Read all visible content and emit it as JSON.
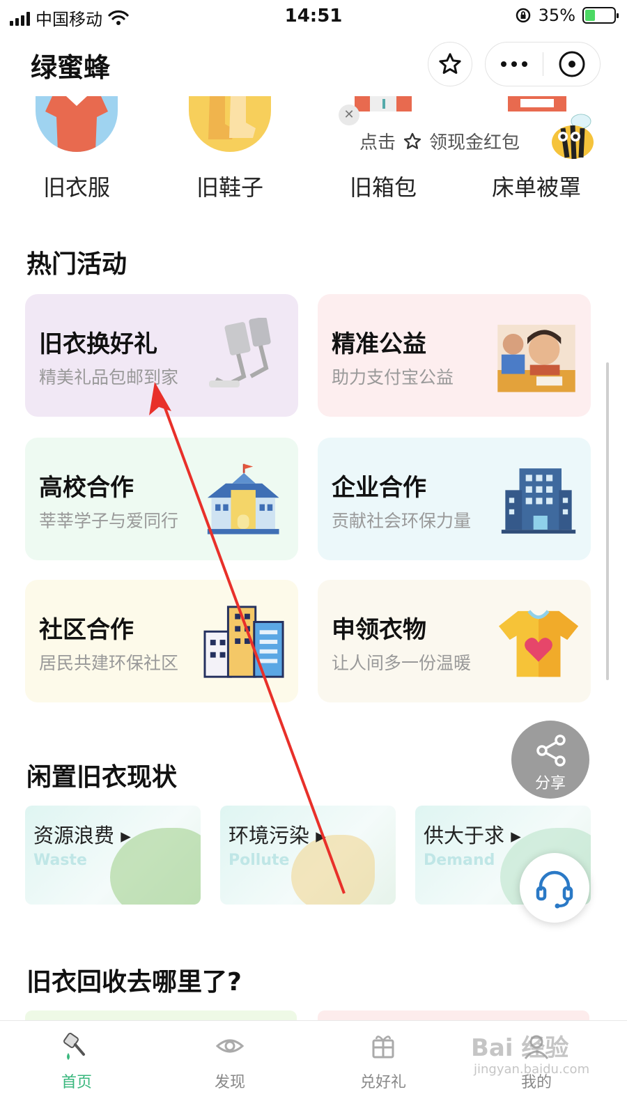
{
  "status_bar": {
    "carrier": "中国移动",
    "time": "14:51",
    "battery_text": "35%",
    "battery_level": 0.35
  },
  "header": {
    "title": "绿蜜蜂"
  },
  "categories": [
    {
      "label": "旧衣服",
      "icon": "shirt-icon"
    },
    {
      "label": "旧鞋子",
      "icon": "boots-icon"
    },
    {
      "label": "旧箱包",
      "icon": "suitcase-icon"
    },
    {
      "label": "床单被罩",
      "icon": "bedding-icon"
    }
  ],
  "red_packet": {
    "prefix": "点击",
    "text": "领现金红包"
  },
  "hot_activities": {
    "title": "热门活动",
    "cards": [
      {
        "title": "旧衣换好礼",
        "subtitle": "精美礼品包邮到家",
        "bg": "#f1e8f5",
        "icon": "phone-stand-icon"
      },
      {
        "title": "精准公益",
        "subtitle": "助力支付宝公益",
        "bg": "#fdeeef",
        "icon": "children-photo"
      },
      {
        "title": "高校合作",
        "subtitle": "莘莘学子与爱同行",
        "bg": "#eefaf2",
        "icon": "school-icon"
      },
      {
        "title": "企业合作",
        "subtitle": "贡献社会环保力量",
        "bg": "#ecf8fa",
        "icon": "office-building-icon"
      },
      {
        "title": "社区合作",
        "subtitle": "居民共建环保社区",
        "bg": "#fdfaea",
        "icon": "community-buildings-icon"
      },
      {
        "title": "申领衣物",
        "subtitle": "让人间多一份温暖",
        "bg": "#fbf8ef",
        "icon": "heart-tshirt-icon"
      }
    ]
  },
  "status_section": {
    "title": "闲置旧衣现状",
    "cards": [
      {
        "title": "资源浪费",
        "en": "Waste"
      },
      {
        "title": "环境污染",
        "en": "Pollute"
      },
      {
        "title": "供大于求",
        "en": "Demand"
      }
    ]
  },
  "where_section": {
    "title": "旧衣回收去哪里了?"
  },
  "share": {
    "label": "分享"
  },
  "tabs": [
    {
      "label": "首页",
      "icon": "home-broom-icon",
      "active": true
    },
    {
      "label": "发现",
      "icon": "eye-icon",
      "active": false
    },
    {
      "label": "兑好礼",
      "icon": "gift-icon",
      "active": false
    },
    {
      "label": "我的",
      "icon": "profile-icon",
      "active": false
    }
  ],
  "watermark": {
    "text": "Bai 经验",
    "sub": "jingyan.baidu.com"
  },
  "colors": {
    "accent_green": "#39b77d",
    "annotation_arrow": "#e8302a"
  }
}
